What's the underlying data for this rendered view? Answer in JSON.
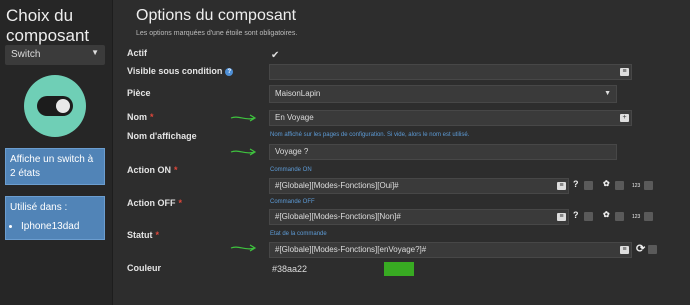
{
  "sidebar": {
    "title": "Choix du composant",
    "type_select": "Switch",
    "description": "Affiche un switch à 2 états",
    "used_in_label": "Utilisé dans :",
    "used_in_items": [
      "Iphone13dad"
    ]
  },
  "header": {
    "title": "Options du composant",
    "subtitle": "Les options marquées d'une étoile sont obligatoires."
  },
  "fields": {
    "actif": {
      "label": "Actif",
      "checked": true
    },
    "visible": {
      "label": "Visible sous condition",
      "value": ""
    },
    "piece": {
      "label": "Pièce",
      "value": "MaisonLapin"
    },
    "nom": {
      "label": "Nom",
      "value": "En Voyage"
    },
    "nom_affichage": {
      "label": "Nom d'affichage",
      "hint": "Nom affiché sur les pages de configuration. Si vide, alors le nom est utilisé.",
      "value": "Voyage ?"
    },
    "action_on": {
      "label": "Action ON",
      "hint": "Commande ON",
      "value": "#[Globale][Modes-Fonctions][Oui]#"
    },
    "action_off": {
      "label": "Action OFF",
      "hint": "Commande OFF",
      "value": "#[Globale][Modes-Fonctions][Non]#"
    },
    "statut": {
      "label": "Statut",
      "hint": "Etat de la commande",
      "value": "#[Globale][Modes-Fonctions][enVoyage?]#"
    },
    "couleur": {
      "label": "Couleur",
      "value": "#38aa22"
    }
  },
  "icons": {
    "question": "?",
    "code_badge": "123",
    "help": "?",
    "plus": "+",
    "refresh": "⟳",
    "list": "≡",
    "chevron": "▼",
    "bullet": "•"
  },
  "colors": {
    "accent_green": "#38aa22",
    "teal": "#6fcfb6",
    "info_blue": "#5184b7",
    "required_red": "#e0473a"
  }
}
